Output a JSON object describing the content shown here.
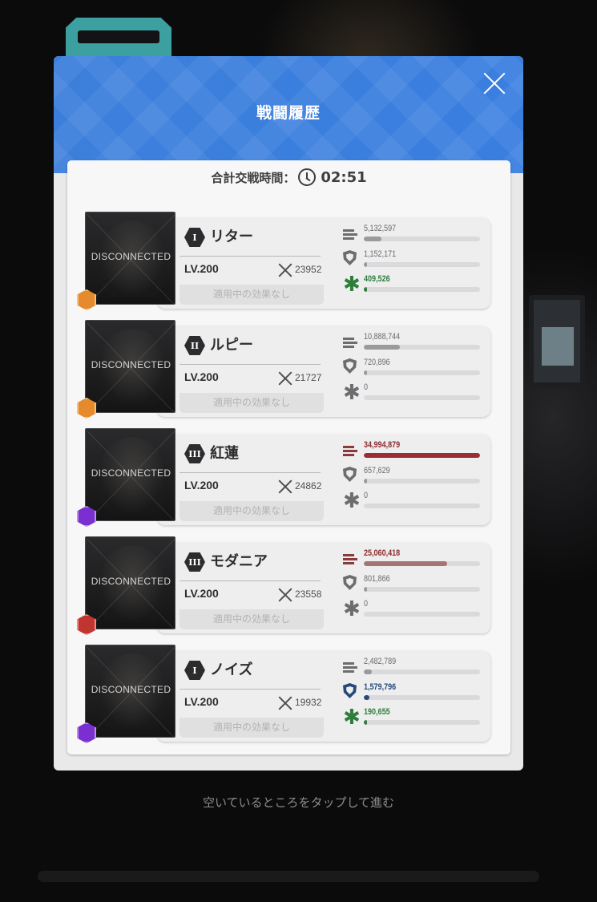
{
  "modal": {
    "title": "戦闘履歴",
    "total_time_label": "合計交戦時間：",
    "total_time_value": "02:51"
  },
  "combatants": [
    {
      "name": "リター",
      "burst": "I",
      "level": "LV.200",
      "power": "23952",
      "status": "DISCONNECTED",
      "effect": "適用中の効果なし",
      "class_icon": "supporter-hex-icon",
      "class_color": "#e58a2d",
      "damage": {
        "value": "5,132,597",
        "fraction": 0.15
      },
      "shield": {
        "value": "1,152,171",
        "fraction": 0.03
      },
      "heal": {
        "value": "409,526",
        "fraction": 0.01
      }
    },
    {
      "name": "ルピー",
      "burst": "II",
      "level": "LV.200",
      "power": "21727",
      "status": "DISCONNECTED",
      "effect": "適用中の効果なし",
      "class_icon": "supporter-hex-icon",
      "class_color": "#e58a2d",
      "damage": {
        "value": "10,888,744",
        "fraction": 0.31
      },
      "shield": {
        "value": "720,896",
        "fraction": 0.02
      },
      "heal": {
        "value": "0",
        "fraction": 0.0
      }
    },
    {
      "name": "紅蓮",
      "burst": "III",
      "level": "LV.200",
      "power": "24862",
      "status": "DISCONNECTED",
      "effect": "適用中の効果なし",
      "class_icon": "lightning-hex-icon",
      "class_color": "#7a2fd1",
      "damage": {
        "value": "34,994,879",
        "fraction": 1.0
      },
      "shield": {
        "value": "657,629",
        "fraction": 0.02
      },
      "heal": {
        "value": "0",
        "fraction": 0.0
      }
    },
    {
      "name": "モダニア",
      "burst": "III",
      "level": "LV.200",
      "power": "23558",
      "status": "DISCONNECTED",
      "effect": "適用中の効果なし",
      "class_icon": "fire-hex-icon",
      "class_color": "#c03530",
      "damage": {
        "value": "25,060,418",
        "fraction": 0.72
      },
      "shield": {
        "value": "801,866",
        "fraction": 0.02
      },
      "heal": {
        "value": "0",
        "fraction": 0.0
      }
    },
    {
      "name": "ノイズ",
      "burst": "I",
      "level": "LV.200",
      "power": "19932",
      "status": "DISCONNECTED",
      "effect": "適用中の効果なし",
      "class_icon": "lightning-hex-icon",
      "class_color": "#7a2fd1",
      "damage": {
        "value": "2,482,789",
        "fraction": 0.07
      },
      "shield": {
        "value": "1,579,796",
        "fraction": 0.05
      },
      "heal": {
        "value": "190,655",
        "fraction": 0.01
      }
    }
  ],
  "footer": {
    "hint": "空いているところをタップして進む"
  }
}
